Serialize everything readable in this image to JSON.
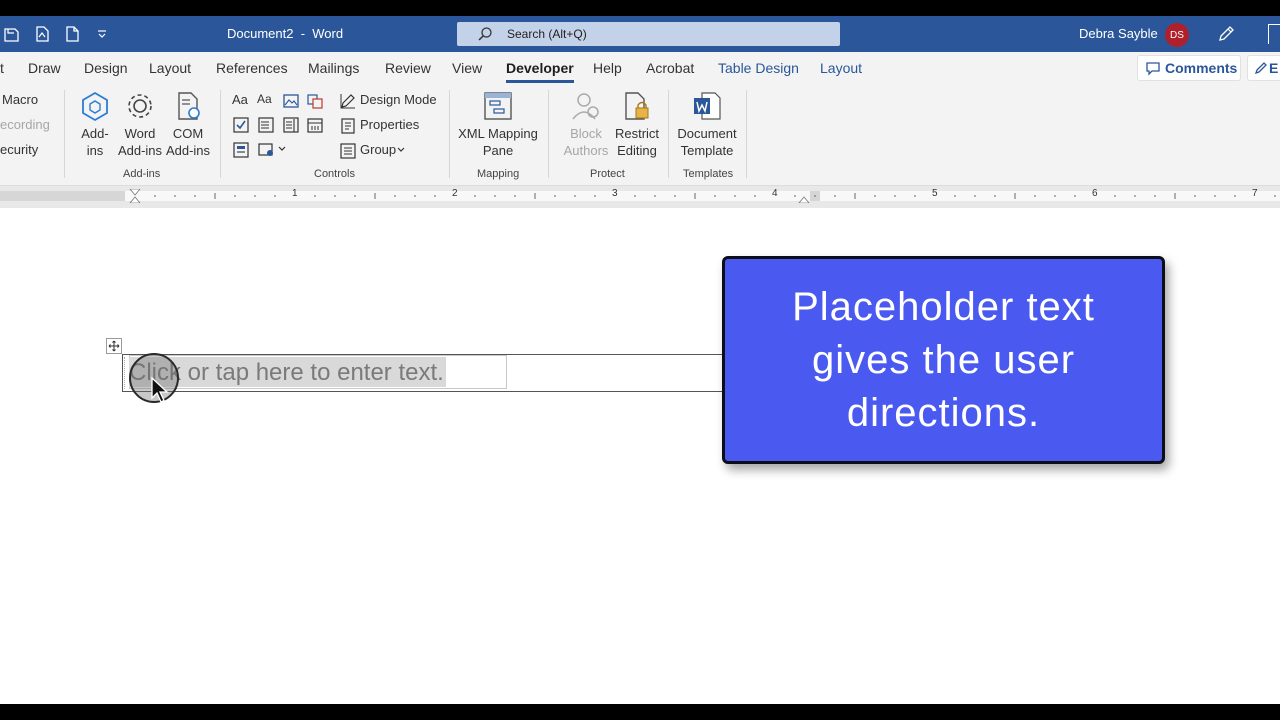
{
  "titlebar": {
    "doc_title": "Document2  -  Word",
    "search_placeholder": "Search (Alt+Q)",
    "user_name": "Debra Sayble",
    "user_initials": "DS"
  },
  "tabs": [
    {
      "label": "t"
    },
    {
      "label": "Draw"
    },
    {
      "label": "Design"
    },
    {
      "label": "Layout"
    },
    {
      "label": "References"
    },
    {
      "label": "Mailings"
    },
    {
      "label": "Review"
    },
    {
      "label": "View"
    },
    {
      "label": "Developer",
      "active": true
    },
    {
      "label": "Help"
    },
    {
      "label": "Acrobat"
    },
    {
      "label": "Table Design",
      "contextual": true
    },
    {
      "label": "Layout",
      "contextual": true
    }
  ],
  "tab_actions": {
    "comments": "Comments",
    "editing": "E"
  },
  "ribbon": {
    "code": {
      "macro": "Macro",
      "recording": "ecording",
      "security": "ecurity"
    },
    "addins": {
      "addins_btn": [
        "Add-",
        "ins"
      ],
      "word_addins_btn": [
        "Word",
        "Add-ins"
      ],
      "com_addins_btn": [
        "COM",
        "Add-ins"
      ],
      "group_label": "Add-ins"
    },
    "controls": {
      "rich_text": "Aa",
      "plain_text": "Aa",
      "design_mode": "Design Mode",
      "properties": "Properties",
      "group": "Group",
      "group_label": "Controls"
    },
    "mapping": {
      "xml_pane": [
        "XML Mapping",
        "Pane"
      ],
      "group_label": "Mapping"
    },
    "protect": {
      "block_authors": [
        "Block",
        "Authors"
      ],
      "restrict_editing": [
        "Restrict",
        "Editing"
      ],
      "group_label": "Protect"
    },
    "templates": {
      "document_template": [
        "Document",
        "Template"
      ],
      "group_label": "Templates"
    }
  },
  "ruler": {
    "numbers": [
      "1",
      "2",
      "3",
      "4",
      "5",
      "6",
      "7"
    ]
  },
  "document": {
    "placeholder_text": "Click or tap here to enter text."
  },
  "callout": {
    "text": "Placeholder text gives the user directions."
  },
  "colors": {
    "title_bar": "#2b579a",
    "ribbon_bg": "#f3f3f3",
    "callout_bg": "#4a5af0",
    "avatar_bg": "#b0202a",
    "placeholder_highlight": "#d9d9d9"
  },
  "icons": [
    "save-icon",
    "save-as-pdf-icon",
    "new-doc-icon",
    "customize-qat-icon",
    "search-icon",
    "pen-icon",
    "comments-icon",
    "edit-icon"
  ]
}
